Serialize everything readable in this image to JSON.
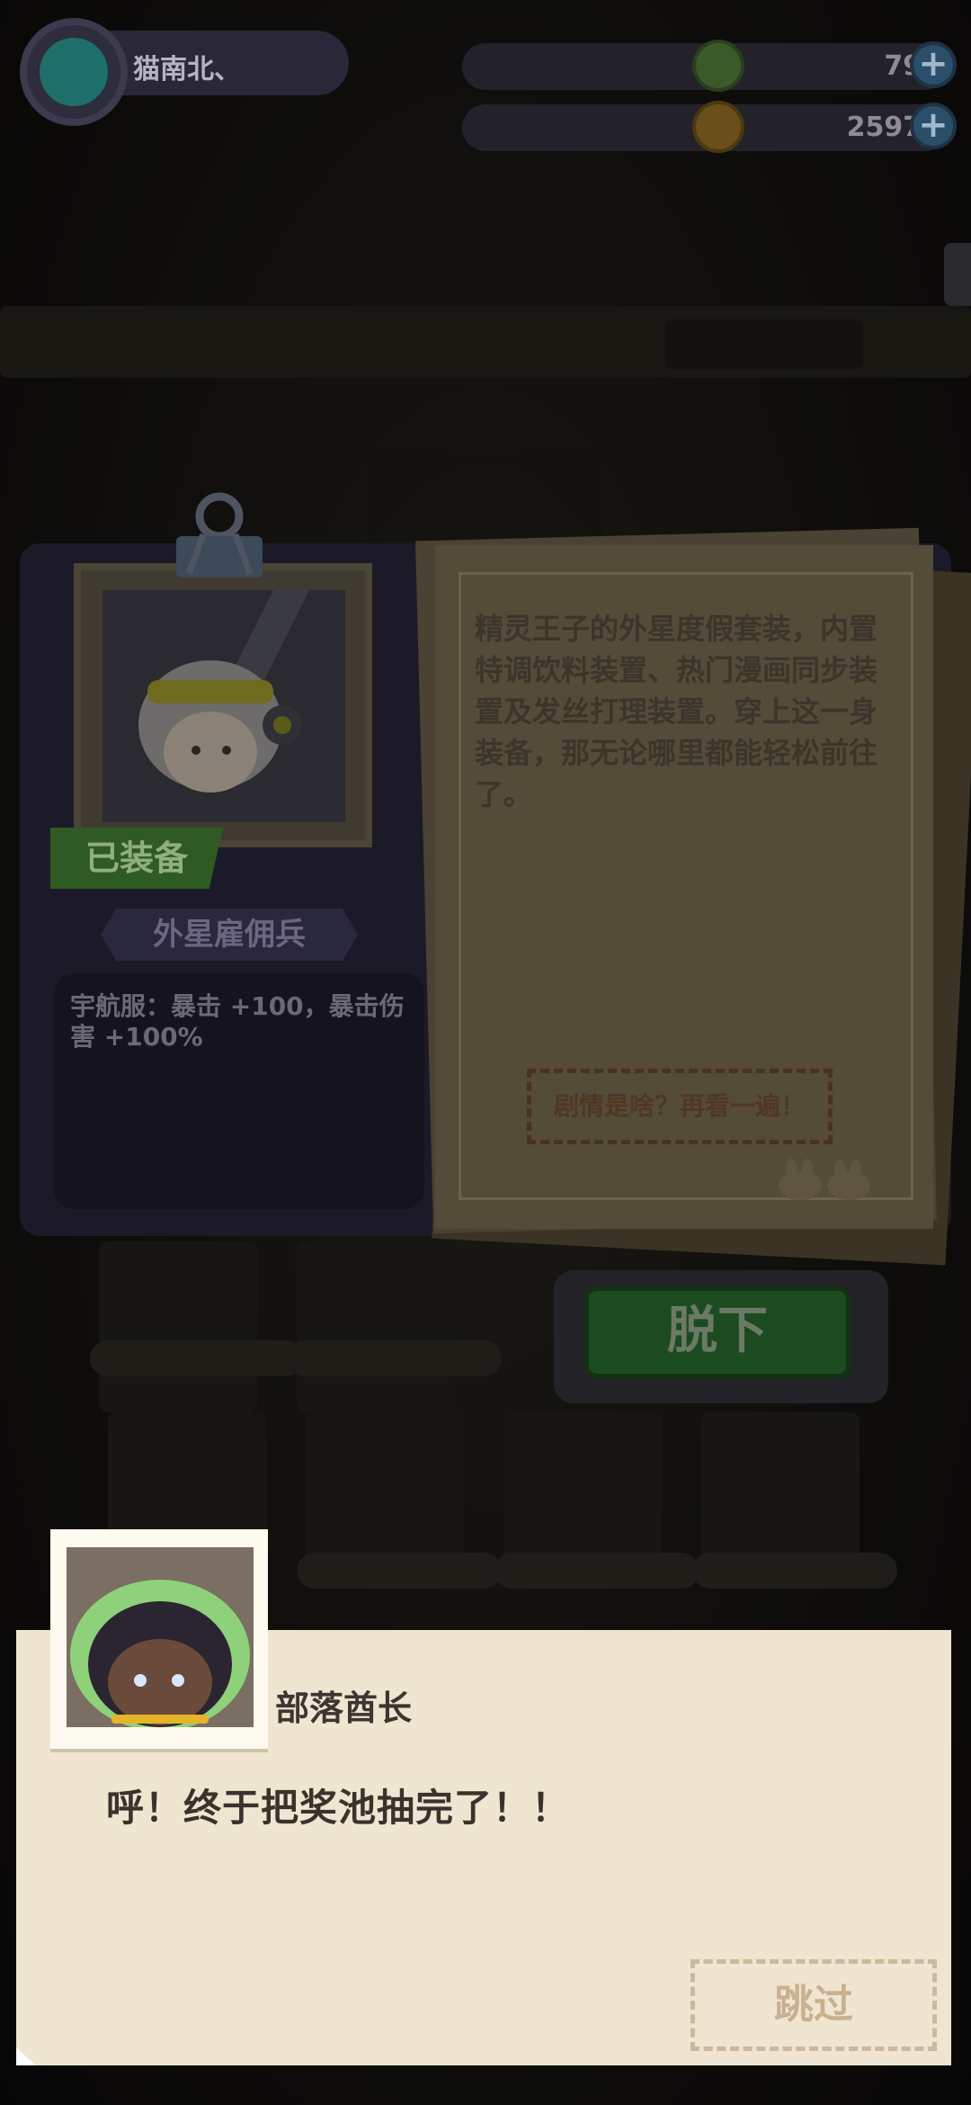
{
  "player": {
    "name": "猫南北、"
  },
  "resources": [
    {
      "icon": "green-gem-icon",
      "value": "797"
    },
    {
      "icon": "gold-coin-icon",
      "value": "25972"
    }
  ],
  "card": {
    "status_tag": "已装备",
    "character_name": "外星雇佣兵",
    "skill": "宇航服：暴击 +100，暴击伤害 +100%",
    "description": "精灵王子的外星度假套装，内置特调饮料装置、热门漫画同步装置及发丝打理装置。穿上这一身装备，那无论哪里都能轻松前往了。",
    "replay_label": "剧情是啥？再看一遍！"
  },
  "takeoff_label": "脱下",
  "dialog": {
    "speaker": "部落酋长",
    "text": "呼！终于把奖池抽完了！！",
    "skip_label": "跳过"
  },
  "colors": {
    "accent_green": "#1d4b20",
    "paper": "#efe5d1",
    "card": "#1c1a28"
  }
}
